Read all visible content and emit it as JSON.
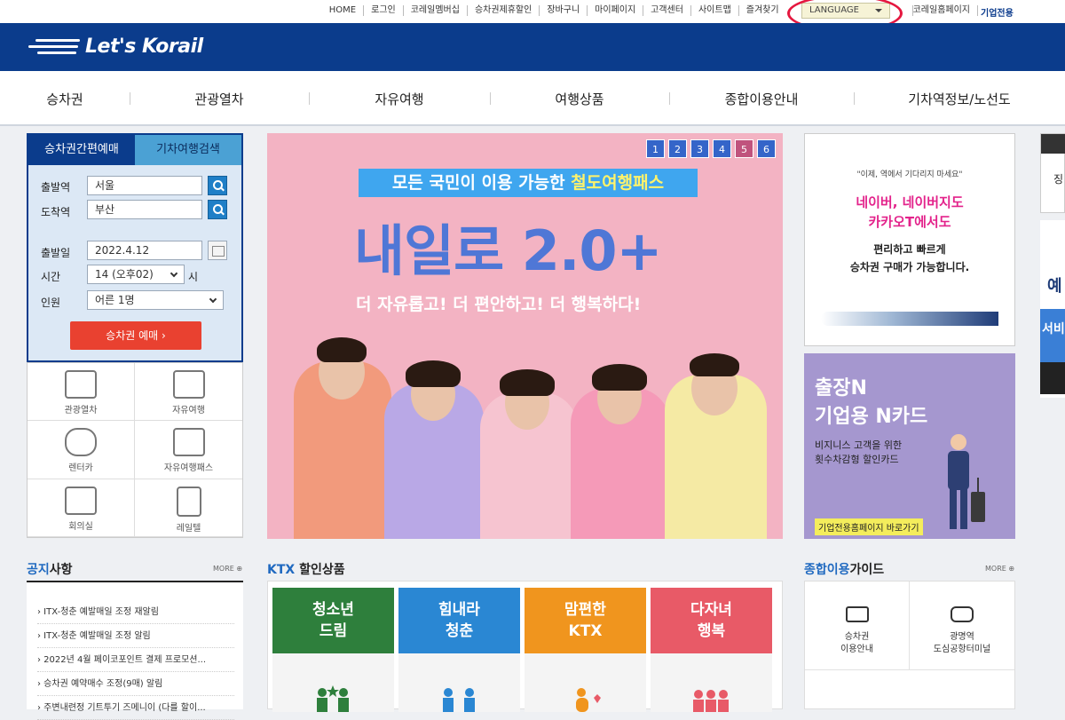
{
  "topbar": {
    "links": [
      "HOME",
      "로그인",
      "코레일멤버십",
      "승차권제휴할인",
      "장바구니",
      "마이페이지",
      "고객센터",
      "사이트맵",
      "즐겨찾기"
    ],
    "language": "LANGUAGE",
    "korail_home": "코레일홈페이지",
    "business": "기업전용"
  },
  "header": {
    "logo_text": "Let's Korail"
  },
  "gnb": [
    "승차권",
    "관광열차",
    "자유여행",
    "여행상품",
    "종합이용안내",
    "기차역정보/노선도"
  ],
  "booking": {
    "tab_active": "승차권간편예매",
    "tab_inactive": "기차여행검색",
    "departure_label": "출발역",
    "departure_value": "서울",
    "arrival_label": "도착역",
    "arrival_value": "부산",
    "date_label": "출발일",
    "date_value": "2022.4.12",
    "time_label": "시간",
    "time_value": "14 (오후02)",
    "time_unit": "시",
    "people_label": "인원",
    "people_value": "어른 1명",
    "reserve_button": "승차권 예매  ›"
  },
  "quick_menu": [
    "관광열차",
    "자유여행",
    "렌터카",
    "자유여행패스",
    "회의실",
    "레일텔"
  ],
  "banner": {
    "pages": [
      "1",
      "2",
      "3",
      "4",
      "5",
      "6"
    ],
    "sub_prefix": "모든 국민이 이용 가능한 ",
    "sub_highlight": "철도여행패스",
    "title": "내일로 2.0+",
    "tagline": "더 자유롭고! 더 편안하고! 더 행복하다!"
  },
  "ad_naver": {
    "quote": "\"이제, 역에서 기다리지 마세요\"",
    "line1": "네이버, 네이버지도",
    "line2": "카카오T에서도",
    "line3": "편리하고 빠르게",
    "line4": "승차권 구매가 가능합니다."
  },
  "ad_card": {
    "title1": "출장N",
    "title2": "기업용 N카드",
    "sub1": "비지니스 고객을 위한",
    "sub2": "횟수차감형 할인카드",
    "button": "기업전용홈페이지 바로가기"
  },
  "edge": {
    "text1": "징",
    "text2": "예",
    "text3": "서비"
  },
  "notice": {
    "title_hl": "공지",
    "title_rest": "사항",
    "more": "MORE",
    "items": [
      "› ITX-청춘 예발매일 조정 재알림",
      "› ITX-청춘 예발매일 조정 알림",
      "› 2022년 4월 페이코포인트 결제 프로모션...",
      "› 승차권 예약매수 조정(9매) 알림",
      "› 주변내련정 기트투기 즈메니이 (다를 할이..."
    ]
  },
  "ktx": {
    "title_hl": "KTX",
    "title_rest": " 할인상품",
    "cards": [
      {
        "line1": "청소년",
        "line2": "드림",
        "color": "#2e7f3c"
      },
      {
        "line1": "힘내라",
        "line2": "청춘",
        "color": "#2a87d3"
      },
      {
        "line1": "맘편한",
        "line2": "KTX",
        "color": "#f0951e"
      },
      {
        "line1": "다자녀",
        "line2": "행복",
        "color": "#e85a67"
      }
    ]
  },
  "guide": {
    "title_hl": "종합이용",
    "title_rest": "가이드",
    "more": "MORE",
    "items": [
      {
        "line1": "승차권",
        "line2": "이용안내"
      },
      {
        "line1": "광명역",
        "line2": "도심공항터미널"
      }
    ]
  }
}
